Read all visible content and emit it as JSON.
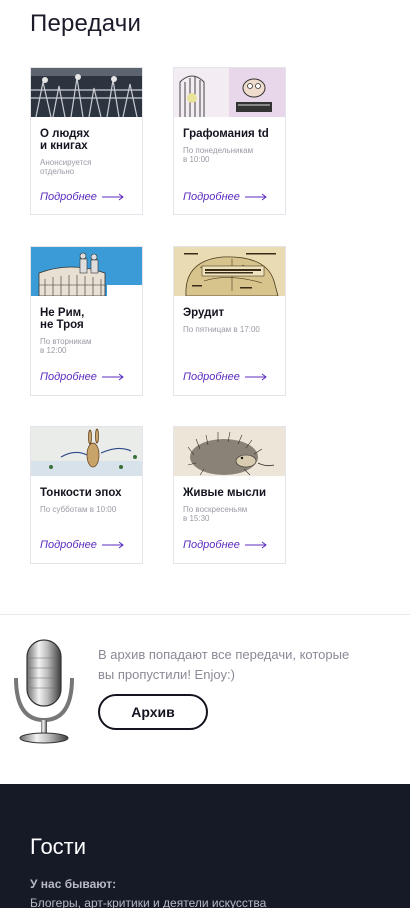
{
  "section_title": "Передачи",
  "shows": [
    {
      "title_line1": "О людях",
      "title_line2": "и книгах",
      "meta_line1": "Анонсируется",
      "meta_line2": "отдельно",
      "more": "Подробнее"
    },
    {
      "title_line1": "Графомания td",
      "title_line2": "",
      "meta_line1": "По понедельникам",
      "meta_line2": "в 10:00",
      "more": "Подробнее"
    },
    {
      "title_line1": "Не Рим,",
      "title_line2": "не Троя",
      "meta_line1": "По вторникам",
      "meta_line2": "в 12:00",
      "more": "Подробнее"
    },
    {
      "title_line1": "Эрудит",
      "title_line2": "",
      "meta_line1": "По пятницам в 17:00",
      "meta_line2": "",
      "more": "Подробнее"
    },
    {
      "title_line1": "Тонкости эпох",
      "title_line2": "",
      "meta_line1": "По субботам в 10:00",
      "meta_line2": "",
      "more": "Подробнее"
    },
    {
      "title_line1": "Живые мысли",
      "title_line2": "",
      "meta_line1": "По воскресеньям",
      "meta_line2": "в 15:30",
      "more": "Подробнее"
    }
  ],
  "archive": {
    "text_line1": "В архив попадают все передачи, которые",
    "text_line2": "вы пропустили! Enjoy:)",
    "button": "Архив"
  },
  "guests": {
    "title": "Гости",
    "subtitle": "У нас бывают:",
    "text": "Блогеры, арт-критики и деятели искусства"
  },
  "colors": {
    "accent": "#5b2bbf",
    "dark_band": "#151a26",
    "meta_gray": "#9a9aa6"
  }
}
